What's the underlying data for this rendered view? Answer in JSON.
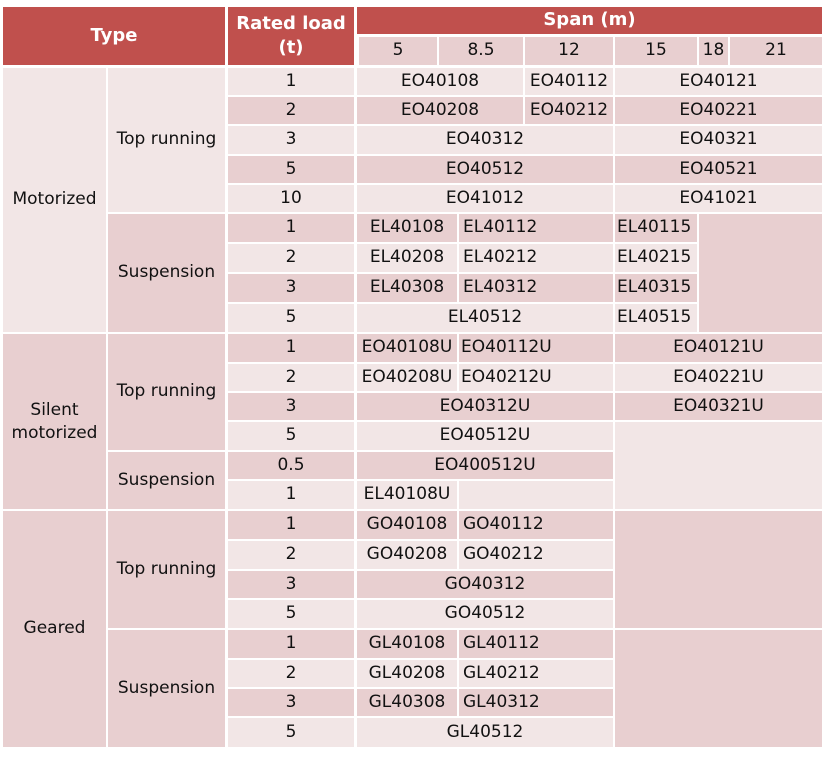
{
  "header": {
    "type_label": "Type",
    "rated_load_label": "Rated load (t)",
    "span_label": "Span (m)",
    "spans": [
      "5",
      "8.5",
      "12",
      "15",
      "18",
      "21"
    ]
  },
  "groups": [
    {
      "type": "Motorized",
      "subgroups": [
        {
          "subtype": "Top running",
          "rows": [
            {
              "load": "1",
              "cells": [
                {
                  "span": "5–8.5",
                  "code": "EO40108"
                },
                {
                  "span": "12",
                  "code": "EO40112"
                },
                {
                  "span": "15–21",
                  "code": "EO40121"
                }
              ]
            },
            {
              "load": "2",
              "cells": [
                {
                  "span": "5–8.5",
                  "code": "EO40208"
                },
                {
                  "span": "12",
                  "code": "EO40212"
                },
                {
                  "span": "15–21",
                  "code": "EO40221"
                }
              ]
            },
            {
              "load": "3",
              "cells": [
                {
                  "span": "5–12",
                  "code": "EO40312"
                },
                {
                  "span": "15–21",
                  "code": "EO40321"
                }
              ]
            },
            {
              "load": "5",
              "cells": [
                {
                  "span": "5–12",
                  "code": "EO40512"
                },
                {
                  "span": "15–21",
                  "code": "EO40521"
                }
              ]
            },
            {
              "load": "10",
              "cells": [
                {
                  "span": "5–12",
                  "code": "EO41012"
                },
                {
                  "span": "15–21",
                  "code": "EO41021"
                }
              ]
            }
          ]
        },
        {
          "subtype": "Suspension",
          "rows": [
            {
              "load": "1",
              "cells": [
                {
                  "span": "5",
                  "code": "EL40108"
                },
                {
                  "span": "8.5–12",
                  "code": "EL40112"
                },
                {
                  "span": "15",
                  "code": "EL40115"
                }
              ]
            },
            {
              "load": "2",
              "cells": [
                {
                  "span": "5",
                  "code": "EL40208"
                },
                {
                  "span": "8.5–12",
                  "code": "EL40212"
                },
                {
                  "span": "15",
                  "code": "EL40215"
                }
              ]
            },
            {
              "load": "3",
              "cells": [
                {
                  "span": "5",
                  "code": "EL40308"
                },
                {
                  "span": "8.5–12",
                  "code": "EL40312"
                },
                {
                  "span": "15",
                  "code": "EL40315"
                }
              ]
            },
            {
              "load": "5",
              "cells": [
                {
                  "span": "5–12",
                  "code": "EL40512"
                },
                {
                  "span": "15",
                  "code": "EL40515"
                }
              ]
            }
          ]
        }
      ]
    },
    {
      "type": "Silent motorized",
      "subgroups": [
        {
          "subtype": "Top running",
          "rows": [
            {
              "load": "1",
              "cells": [
                {
                  "span": "5",
                  "code": "EO40108U"
                },
                {
                  "span": "8.5–12",
                  "code": "EO40112U"
                },
                {
                  "span": "15–21",
                  "code": "EO40121U"
                }
              ]
            },
            {
              "load": "2",
              "cells": [
                {
                  "span": "5",
                  "code": "EO40208U"
                },
                {
                  "span": "8.5–12",
                  "code": "EO40212U"
                },
                {
                  "span": "15–21",
                  "code": "EO40221U"
                }
              ]
            },
            {
              "load": "3",
              "cells": [
                {
                  "span": "5–12",
                  "code": "EO40312U"
                },
                {
                  "span": "15–21",
                  "code": "EO40321U"
                }
              ]
            },
            {
              "load": "5",
              "cells": [
                {
                  "span": "5–12",
                  "code": "EO40512U"
                }
              ]
            }
          ]
        },
        {
          "subtype": "Suspension",
          "rows": [
            {
              "load": "0.5",
              "cells": [
                {
                  "span": "5–12",
                  "code": "EO400512U"
                }
              ]
            },
            {
              "load": "1",
              "cells": [
                {
                  "span": "5",
                  "code": "EL40108U"
                }
              ]
            }
          ]
        }
      ]
    },
    {
      "type": "Geared",
      "subgroups": [
        {
          "subtype": "Top running",
          "rows": [
            {
              "load": "1",
              "cells": [
                {
                  "span": "5",
                  "code": "GO40108"
                },
                {
                  "span": "8.5–12",
                  "code": "GO40112"
                }
              ]
            },
            {
              "load": "2",
              "cells": [
                {
                  "span": "5",
                  "code": "GO40208"
                },
                {
                  "span": "8.5–12",
                  "code": "GO40212"
                }
              ]
            },
            {
              "load": "3",
              "cells": [
                {
                  "span": "5–12",
                  "code": "GO40312"
                }
              ]
            },
            {
              "load": "5",
              "cells": [
                {
                  "span": "5–12",
                  "code": "GO40512"
                }
              ]
            }
          ]
        },
        {
          "subtype": "Suspension",
          "rows": [
            {
              "load": "1",
              "cells": [
                {
                  "span": "5",
                  "code": "GL40108"
                },
                {
                  "span": "8.5–12",
                  "code": "GL40112"
                }
              ]
            },
            {
              "load": "2",
              "cells": [
                {
                  "span": "5",
                  "code": "GL40208"
                },
                {
                  "span": "8.5–12",
                  "code": "GL40212"
                }
              ]
            },
            {
              "load": "3",
              "cells": [
                {
                  "span": "5",
                  "code": "GL40308"
                },
                {
                  "span": "8.5–12",
                  "code": "GL40312"
                }
              ]
            },
            {
              "load": "5",
              "cells": [
                {
                  "span": "5–12",
                  "code": "GL40512"
                }
              ]
            }
          ]
        }
      ]
    }
  ],
  "colors": {
    "header_bg": "#c0504d",
    "band_dark": "#e8cfd0",
    "band_light": "#f2e6e6"
  }
}
